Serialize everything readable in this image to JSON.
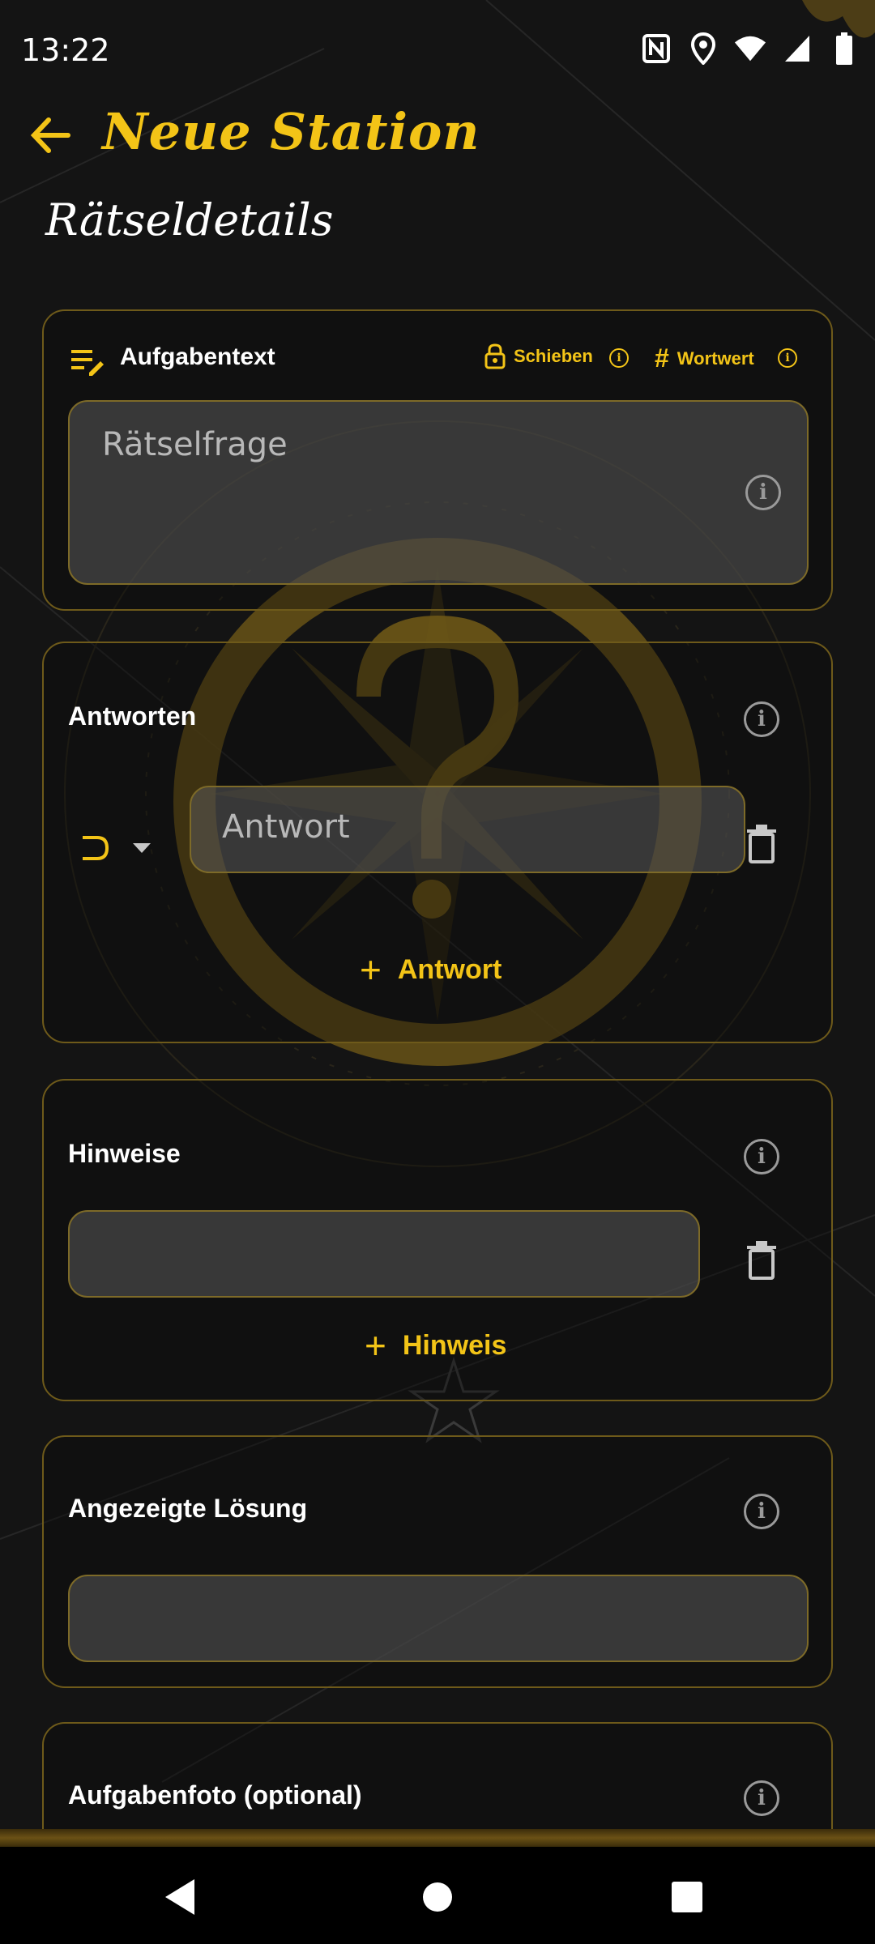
{
  "status_bar": {
    "time": "13:22"
  },
  "header": {
    "title": "Neue Station",
    "subtitle": "Rätseldetails"
  },
  "task_card": {
    "label": "Aufgabentext",
    "lock_label": "Schieben",
    "hash_label": "Wortwert",
    "question_placeholder": "Rätselfrage"
  },
  "answers_card": {
    "label": "Antworten",
    "answer_placeholder": "Antwort",
    "add_label": "Antwort"
  },
  "hints_card": {
    "label": "Hinweise",
    "hint_placeholder": "",
    "add_label": "Hinweis"
  },
  "solution_card": {
    "label": "Angezeigte Lösung",
    "solution_placeholder": ""
  },
  "photo_card": {
    "label": "Aufgabenfoto (optional)"
  },
  "colors": {
    "accent": "#f3c417",
    "card_border": "#6e5a1a",
    "background": "#141414",
    "field_bg": "#5a5a5a"
  }
}
